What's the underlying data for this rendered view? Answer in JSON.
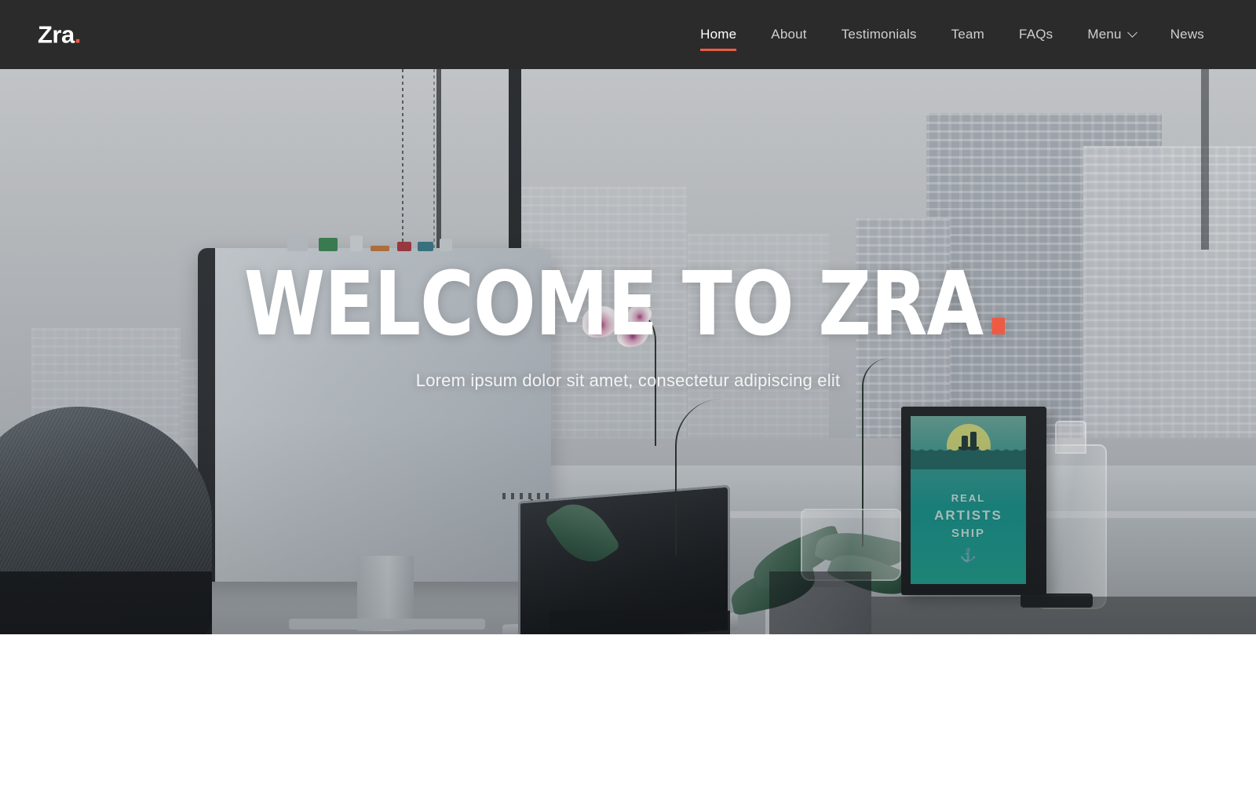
{
  "header": {
    "logo": {
      "text": "Zra",
      "dot": "."
    },
    "nav": [
      {
        "label": "Home",
        "active": true,
        "has_dropdown": false
      },
      {
        "label": "About",
        "active": false,
        "has_dropdown": false
      },
      {
        "label": "Testimonials",
        "active": false,
        "has_dropdown": false
      },
      {
        "label": "Team",
        "active": false,
        "has_dropdown": false
      },
      {
        "label": "FAQs",
        "active": false,
        "has_dropdown": false
      },
      {
        "label": "Menu",
        "active": false,
        "has_dropdown": true
      },
      {
        "label": "News",
        "active": false,
        "has_dropdown": false
      }
    ]
  },
  "hero": {
    "title": "Welcome to Zra",
    "title_dot": ".",
    "subtitle": "Lorem ipsum dolor sit amet, consectetur adipiscing elit",
    "photo_description": "Desk by a window with iMac, laptop, orchid plant and city skyline"
  },
  "hero_photo": {
    "framed_poster": {
      "line1": "REAL",
      "line2": "ARTISTS",
      "line3": "SHIP",
      "anchor_glyph": "⚓"
    }
  },
  "colors": {
    "accent": "#ee5b42",
    "header_bg": "#2b2b2b",
    "nav_text": "#cfcfcf",
    "nav_active_text": "#ffffff",
    "hero_text": "#ffffff",
    "page_bg": "#ffffff"
  }
}
